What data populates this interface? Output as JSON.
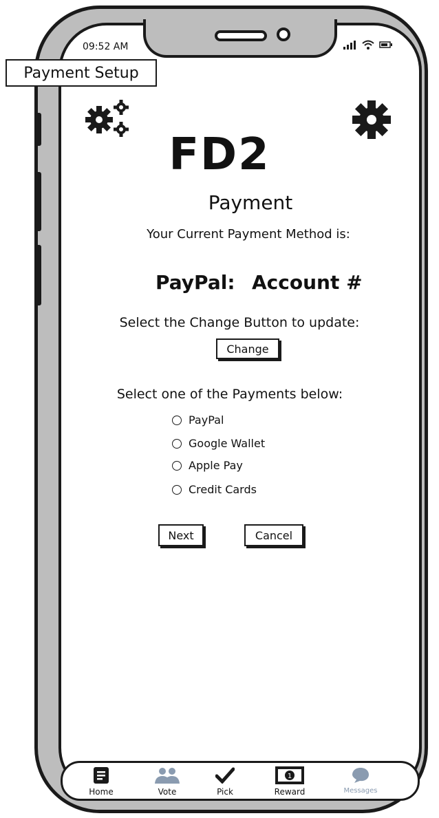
{
  "status_bar": {
    "time": "09:52 AM",
    "signal_icon": "signal-icon",
    "wifi_icon": "wifi-icon",
    "battery_icon": "battery-icon"
  },
  "window_title": "Payment Setup",
  "header": {
    "left_icon": "gears-icon",
    "right_icon": "gear-icon"
  },
  "brand": "FD2",
  "page": {
    "subtitle": "Payment",
    "current_method_label": "Your Current Payment Method is:",
    "current_provider": "PayPal:",
    "current_account": "Account #",
    "change_hint": "Select the Change Button to update:",
    "change_label": "Change",
    "select_hint": "Select one of the Payments below:",
    "options": [
      "PayPal",
      "Google Wallet",
      "Apple Pay",
      "Credit Cards"
    ],
    "next_label": "Next",
    "cancel_label": "Cancel"
  },
  "tabs": [
    {
      "label": "Home",
      "icon": "home-icon"
    },
    {
      "label": "Vote",
      "icon": "users-icon"
    },
    {
      "label": "Pick",
      "icon": "checkmark-icon"
    },
    {
      "label": "Reward",
      "icon": "money-icon"
    },
    {
      "label": "Messages",
      "icon": "chat-bubble-icon"
    }
  ],
  "colors": {
    "frame": "#1a1a1a",
    "bezel": "#bdbdbd",
    "inactive_tab": "#8a9bb0"
  }
}
